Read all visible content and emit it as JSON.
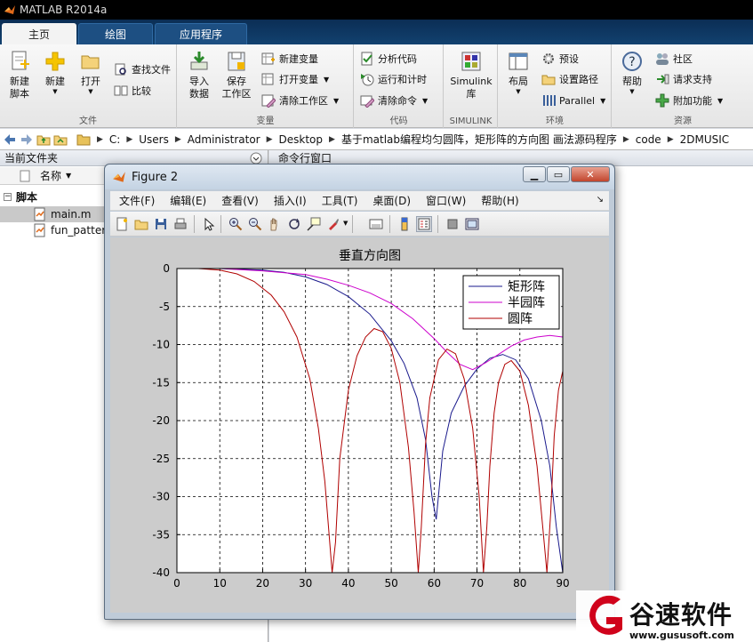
{
  "app": {
    "title": "MATLAB R2014a"
  },
  "ribbon_tabs": [
    {
      "label": "主页",
      "active": true
    },
    {
      "label": "绘图",
      "active": false
    },
    {
      "label": "应用程序",
      "active": false
    }
  ],
  "ribbon": {
    "file": {
      "label": "文件",
      "new_script": {
        "line1": "新建",
        "line2": "脚本"
      },
      "new": "新建",
      "open": "打开",
      "find_files": "查找文件",
      "compare": "比较"
    },
    "variable": {
      "label": "变量",
      "import": {
        "line1": "导入",
        "line2": "数据"
      },
      "save_ws": {
        "line1": "保存",
        "line2": "工作区"
      },
      "new_var": "新建变量",
      "open_var": "打开变量",
      "clear_ws": "清除工作区"
    },
    "code": {
      "label": "代码",
      "analyze": "分析代码",
      "run_time": "运行和计时",
      "clear_cmd": "清除命令"
    },
    "simulink": {
      "label": "SIMULINK",
      "lib": {
        "line1": "Simulink",
        "line2": "库"
      }
    },
    "env": {
      "label": "环境",
      "layout": "布局",
      "prefs": "预设",
      "set_path": "设置路径",
      "parallel": "Parallel"
    },
    "resources": {
      "label": "资源",
      "help": "帮助",
      "community": "社区",
      "support": "请求支持",
      "addons": "附加功能"
    }
  },
  "address": {
    "crumbs": [
      "C:",
      "Users",
      "Administrator",
      "Desktop",
      "基于matlab编程均匀圆阵，矩形阵的方向图 画法源码程序",
      "code",
      "2DMUSIC"
    ]
  },
  "left_panel": {
    "title": "当前文件夹",
    "column_name": "名称",
    "folder": "脚本",
    "files": [
      "main.m",
      "fun_pattern"
    ]
  },
  "right_panel": {
    "title": "命令行窗口"
  },
  "figure": {
    "title": "Figure 2",
    "menu": [
      "文件(F)",
      "编辑(E)",
      "查看(V)",
      "插入(I)",
      "工具(T)",
      "桌面(D)",
      "窗口(W)",
      "帮助(H)"
    ]
  },
  "chart_data": {
    "type": "line",
    "title": "垂直方向图",
    "xlabel": "",
    "ylabel": "",
    "xlim": [
      0,
      90
    ],
    "ylim": [
      -40,
      0
    ],
    "x_ticks": [
      0,
      10,
      20,
      30,
      40,
      50,
      60,
      70,
      80,
      90
    ],
    "y_ticks": [
      0,
      -5,
      -10,
      -15,
      -20,
      -25,
      -30,
      -35,
      -40
    ],
    "grid": true,
    "legend_position": "top-right",
    "series": [
      {
        "name": "矩形阵",
        "color": "#1a1a8c",
        "x": [
          0,
          10,
          20,
          25,
          30,
          35,
          40,
          45,
          50,
          53,
          56,
          58,
          59.5,
          60.5,
          62,
          64,
          67,
          70,
          73,
          76,
          79,
          82,
          85,
          87,
          88.5,
          90
        ],
        "y": [
          0,
          0,
          -0.2,
          -0.5,
          -1.1,
          -2.1,
          -3.7,
          -6.0,
          -9.5,
          -12.5,
          -17.0,
          -22.5,
          -30.0,
          -33.0,
          -24.0,
          -19.0,
          -15.5,
          -13.2,
          -11.8,
          -11.3,
          -12.0,
          -14.5,
          -20.0,
          -26.0,
          -34.0,
          -40
        ]
      },
      {
        "name": "半园阵",
        "color": "#cc00cc",
        "x": [
          0,
          10,
          20,
          30,
          35,
          40,
          45,
          50,
          55,
          60,
          63,
          66,
          69,
          72,
          75,
          78,
          81,
          84,
          87,
          90
        ],
        "y": [
          0,
          0,
          -0.3,
          -0.8,
          -1.4,
          -2.2,
          -3.2,
          -4.6,
          -6.6,
          -9.2,
          -11.0,
          -12.6,
          -13.3,
          -12.4,
          -11.3,
          -10.2,
          -9.4,
          -9.0,
          -8.8,
          -9.0
        ]
      },
      {
        "name": "圆阵",
        "color": "#b00000",
        "x": [
          0,
          5,
          10,
          14,
          18,
          22,
          25,
          28,
          31,
          33,
          34.5,
          35.5,
          36.2,
          37,
          38,
          40,
          42,
          44,
          46,
          48,
          50,
          52,
          54,
          55.3,
          56.3,
          57,
          58,
          59,
          61,
          63,
          65,
          67,
          69,
          70.5,
          71.5,
          72.3,
          73,
          74,
          75,
          76.5,
          78,
          80,
          82,
          84,
          85.5,
          86.3,
          87.2,
          88,
          89,
          90
        ],
        "y": [
          0,
          0,
          -0.2,
          -0.7,
          -1.7,
          -3.5,
          -5.7,
          -9.0,
          -14.5,
          -21.0,
          -28.0,
          -35.0,
          -40,
          -36.0,
          -25.0,
          -16.0,
          -11.5,
          -9.0,
          -7.9,
          -8.3,
          -10.5,
          -15.0,
          -23.5,
          -32.0,
          -40,
          -34.0,
          -23.0,
          -17.0,
          -12.0,
          -10.6,
          -11.2,
          -14.5,
          -21.0,
          -30.0,
          -40,
          -34.0,
          -26.0,
          -19.0,
          -15.0,
          -12.6,
          -12.1,
          -13.5,
          -18.0,
          -26.0,
          -35.0,
          -40,
          -32.0,
          -22.0,
          -16.0,
          -13.5
        ]
      }
    ]
  },
  "watermark": {
    "brand": "谷速软件",
    "url": "www.gususoft.com",
    "logo_color": "#d0021b"
  }
}
